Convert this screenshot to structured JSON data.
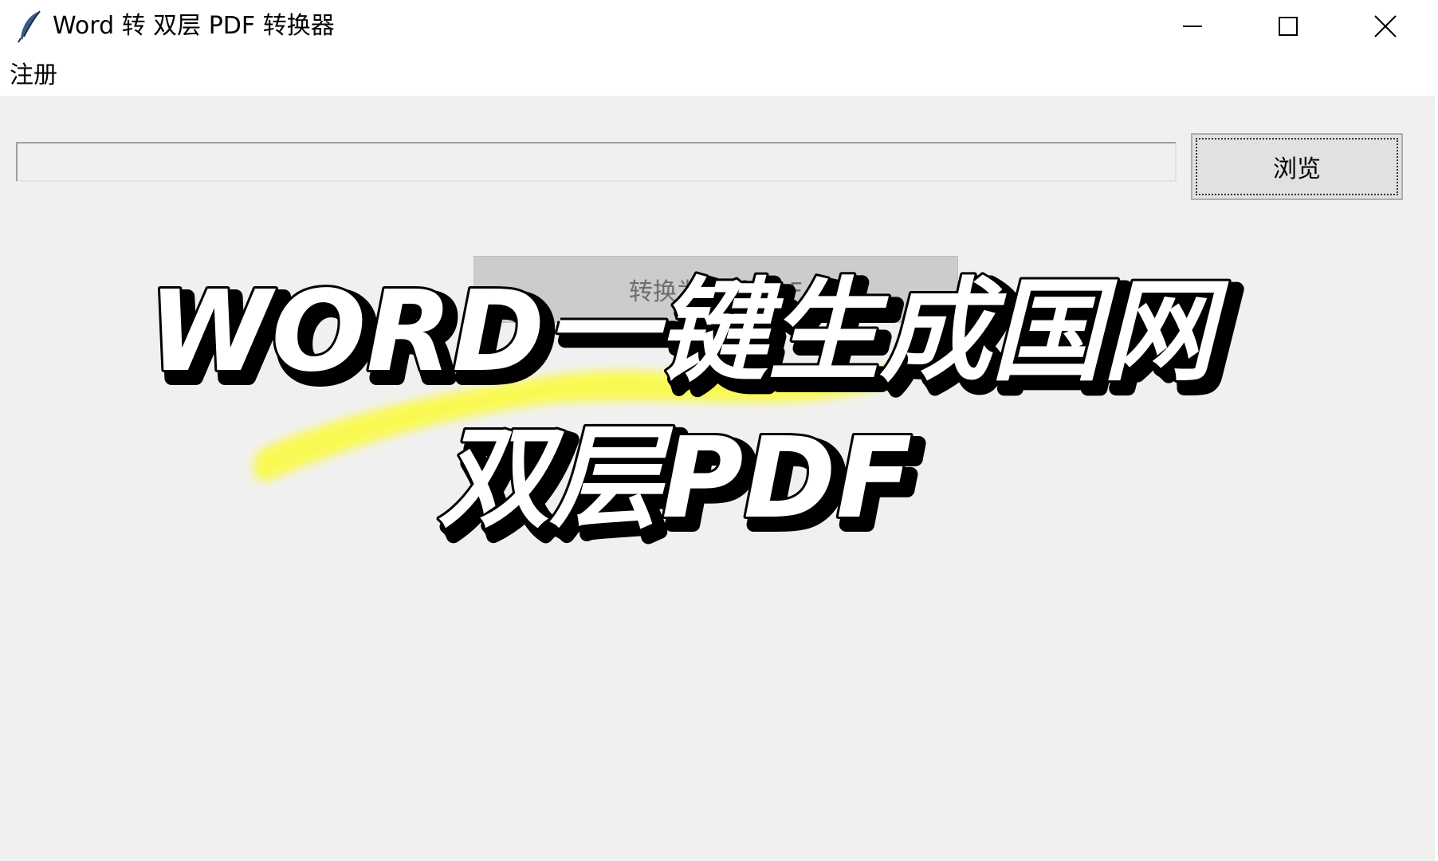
{
  "window": {
    "title": "Word 转 双层 PDF 转换器",
    "controls": {
      "minimize_icon": "minimize-icon",
      "maximize_icon": "maximize-icon",
      "close_icon": "close-icon"
    }
  },
  "menu": {
    "items": [
      {
        "label": "注册"
      }
    ]
  },
  "form": {
    "path_value": "",
    "path_placeholder": "",
    "browse_label": "浏览",
    "convert_label": "转换为双层 PDF"
  },
  "overlay": {
    "line1": "WORD一键生成国网",
    "line2": "双层PDF",
    "highlight_color": "#fafa4c"
  },
  "colors": {
    "window_bg": "#f0f0f0",
    "titlebar_bg": "#ffffff",
    "button_bg": "#e1e1e1",
    "disabled_button_bg": "#cccccc"
  }
}
